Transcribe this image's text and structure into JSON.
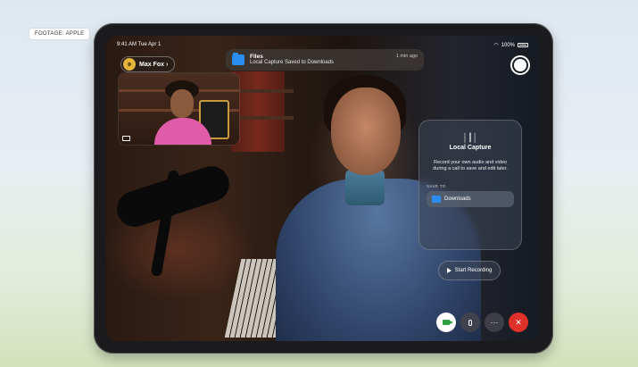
{
  "footage_tag": "FOOTAGE: APPLE",
  "status_bar": {
    "time": "9:41 AM  Tue Apr 1",
    "battery": "100%"
  },
  "caller": {
    "name": "Max Fox ›"
  },
  "notification": {
    "app": "Files",
    "message": "Local Capture Saved to Downloads",
    "time": "1 min ago"
  },
  "local_capture_panel": {
    "icon": "waveform-icon",
    "title": "Local Capture",
    "description": "Record your own audio and video during a call to save and edit later.",
    "save_to_label": "SAVE TO",
    "destination": "Downloads"
  },
  "start_recording_label": "Start Recording",
  "controls": {
    "video": "video-icon",
    "mic": "mic-icon",
    "more_label": "···",
    "end_label": "✕"
  },
  "colors": {
    "end_call": "#e0302a",
    "video_active": "#2ea043",
    "folder": "#2a8ef0"
  }
}
